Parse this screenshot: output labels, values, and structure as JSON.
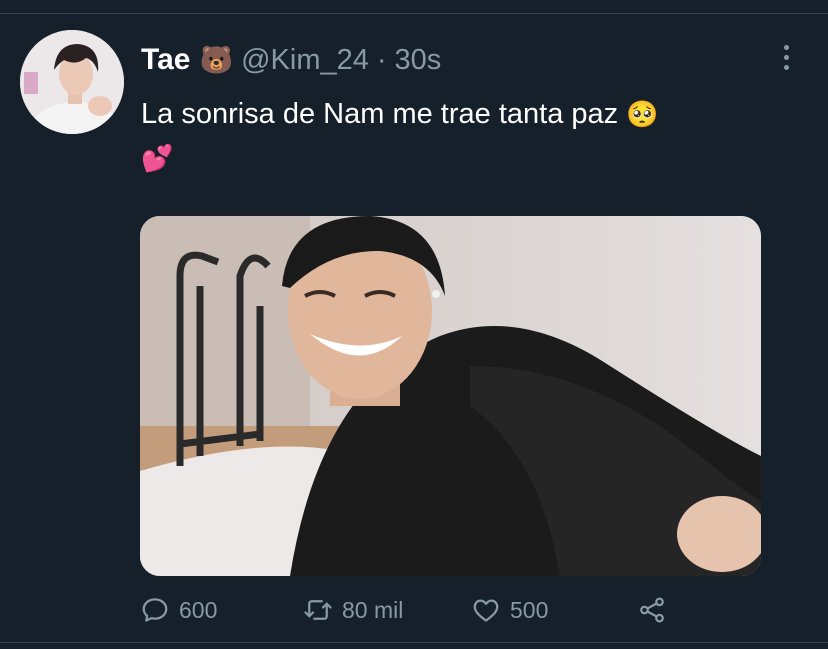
{
  "tweet": {
    "author_name": "Tae",
    "author_emoji": "🐻",
    "handle": "@Kim_24",
    "separator": "·",
    "time": "30s",
    "text": "La sonrisa de Nam me trae tanta paz",
    "text_emoji_1": "🥺",
    "text_emoji_2": "💕"
  },
  "actions": {
    "replies": "600",
    "retweets": "80 mil",
    "likes": "500"
  },
  "icons": {
    "more": "more-vertical-icon",
    "reply": "speech-bubble-icon",
    "retweet": "retweet-icon",
    "like": "heart-icon",
    "share": "share-icon"
  },
  "colors": {
    "background": "#15202b",
    "secondary_text": "#8899a6",
    "divider": "#38444d"
  }
}
